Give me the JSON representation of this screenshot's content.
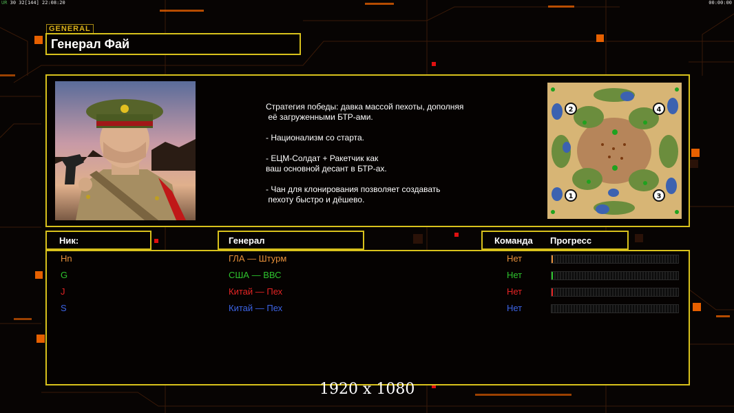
{
  "hud": {
    "left_prefix": "UR",
    "left_rest": " 30 32[144] 22:08:20",
    "right": "00:00:00"
  },
  "tag": "GENERAL",
  "title": "Генерал Фай",
  "description": [
    "Стратегия победы: давка массой пехоты, дополняя",
    " её загруженными БТР-ами.",
    "",
    "- Национализм со старта.",
    "",
    "- ЕЦМ-Солдат + Ракетчик как",
    "ваш основной десант в БТР-ах.",
    "",
    "- Чан для клонирования позволяет создавать",
    " пехоту быстро и дёшево."
  ],
  "minimap": {
    "spawns": [
      "1",
      "2",
      "3",
      "4"
    ]
  },
  "headers": {
    "nick": "Ник:",
    "general": "Генерал",
    "team": "Команда",
    "progress": "Прогресс"
  },
  "players": [
    {
      "nick": "Hn",
      "general": "ГЛА — Штурм",
      "team": "Нет",
      "color": "#e8903a",
      "progress": 0.01
    },
    {
      "nick": "G",
      "general": "США — ВВС",
      "team": "Нет",
      "color": "#2ec42e",
      "progress": 0.005
    },
    {
      "nick": "J",
      "general": "Китай — Пех",
      "team": "Нет",
      "color": "#e52424",
      "progress": 0.01
    },
    {
      "nick": "S",
      "general": "Китай — Пех",
      "team": "Нет",
      "color": "#3c64e6",
      "progress": 0
    }
  ],
  "resolution": "1920 x 1080",
  "colors": {
    "frame": "#d9c21c",
    "accent": "#ff6a00"
  }
}
